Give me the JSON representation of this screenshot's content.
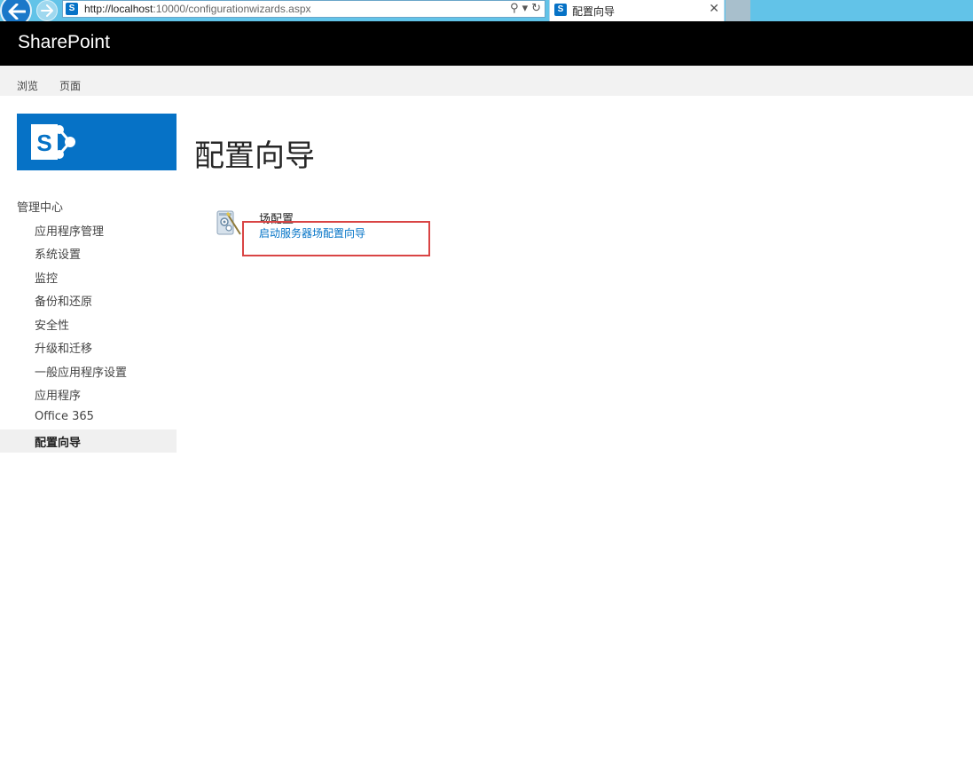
{
  "browser": {
    "url_host": "http://localhost",
    "url_rest": ":10000/configurationwizards.aspx",
    "favicon_letter": "S",
    "tab_title": "配置向导",
    "tab_close": "✕",
    "search_icon": "search-icon",
    "refresh_icon": "refresh-icon"
  },
  "suite": {
    "title": "SharePoint"
  },
  "ribbon": {
    "tabs": [
      "浏览",
      "页面"
    ]
  },
  "nav": {
    "header": "管理中心",
    "items": [
      "应用程序管理",
      "系统设置",
      "监控",
      "备份和还原",
      "安全性",
      "升级和迁移",
      "一般应用程序设置",
      "应用程序",
      "Office 365",
      "配置向导"
    ],
    "selected_index": 9
  },
  "main": {
    "title": "配置向导",
    "group_heading": "场配置",
    "link_text": "启动服务器场配置向导"
  },
  "colors": {
    "brand_blue": "#0672c6",
    "link_blue": "#0072c6",
    "suite_bar": "#000000",
    "highlight_red": "#d94444"
  }
}
